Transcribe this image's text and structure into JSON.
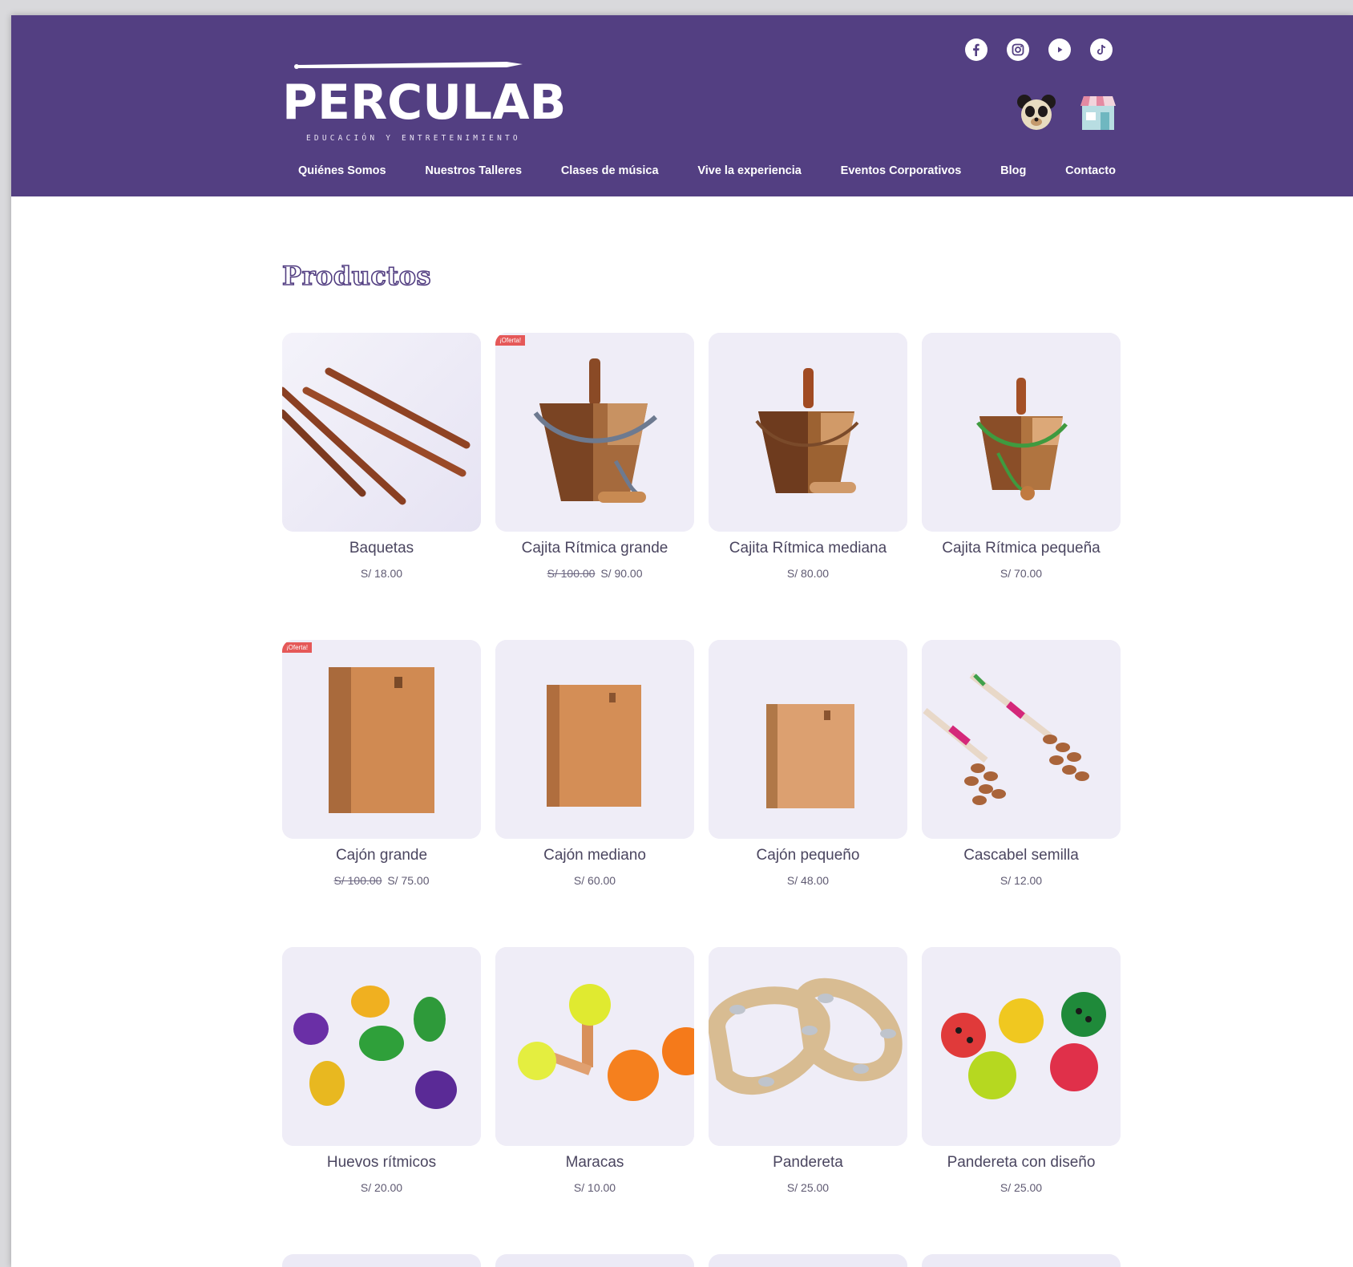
{
  "site": {
    "logo_text": "PERCULAB",
    "tagline": "EDUCACIÓN Y ENTRETENIMIENTO",
    "social_icons": [
      "facebook-icon",
      "instagram-icon",
      "youtube-icon",
      "tiktok-icon"
    ],
    "badge_icons": [
      "bear-icon",
      "store-icon"
    ]
  },
  "nav": {
    "items": [
      {
        "label": "Quiénes Somos"
      },
      {
        "label": "Nuestros Talleres"
      },
      {
        "label": "Clases de música"
      },
      {
        "label": "Vive la experiencia"
      },
      {
        "label": "Eventos Corporativos"
      },
      {
        "label": "Blog"
      },
      {
        "label": "Contacto"
      }
    ]
  },
  "main": {
    "title": "Productos",
    "offer_label": "¡Oferta!",
    "products": [
      {
        "name": "Baquetas",
        "price": "S/ 18.00",
        "old_price": ""
      },
      {
        "name": "Cajita Rítmica grande",
        "price": "S/ 90.00",
        "old_price": "S/ 100.00"
      },
      {
        "name": "Cajita Rítmica mediana",
        "price": "S/ 80.00",
        "old_price": ""
      },
      {
        "name": "Cajita Rítmica pequeña",
        "price": "S/ 70.00",
        "old_price": ""
      },
      {
        "name": "Cajón grande",
        "price": "S/ 75.00",
        "old_price": "S/ 100.00"
      },
      {
        "name": "Cajón mediano",
        "price": "S/ 60.00",
        "old_price": ""
      },
      {
        "name": "Cajón pequeño",
        "price": "S/ 48.00",
        "old_price": ""
      },
      {
        "name": "Cascabel semilla",
        "price": "S/ 12.00",
        "old_price": ""
      },
      {
        "name": "Huevos rítmicos",
        "price": "S/ 20.00",
        "old_price": ""
      },
      {
        "name": "Maracas",
        "price": "S/ 10.00",
        "old_price": ""
      },
      {
        "name": "Pandereta",
        "price": "S/ 25.00",
        "old_price": ""
      },
      {
        "name": "Pandereta con diseño",
        "price": "S/ 25.00",
        "old_price": ""
      }
    ]
  },
  "colors": {
    "header_bg": "#533f82",
    "offer_badge": "#e55858",
    "card_bg": "#eceaf6"
  }
}
